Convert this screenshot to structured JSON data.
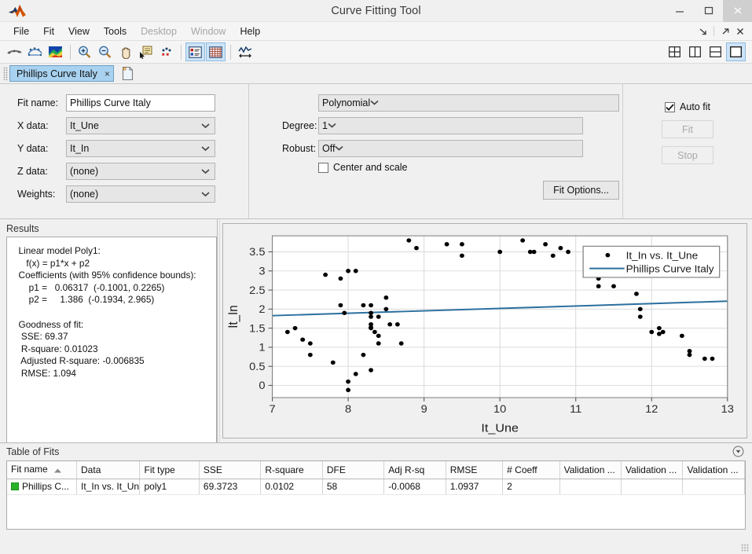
{
  "window": {
    "title": "Curve Fitting Tool",
    "logo_icon": "matlab-logo-icon",
    "minimize_label": "–",
    "maximize_label": "❐",
    "close_label": "✕"
  },
  "menubar": {
    "items": [
      {
        "label": "File",
        "disabled": false
      },
      {
        "label": "Fit",
        "disabled": false
      },
      {
        "label": "View",
        "disabled": false
      },
      {
        "label": "Tools",
        "disabled": false
      },
      {
        "label": "Desktop",
        "disabled": true
      },
      {
        "label": "Window",
        "disabled": true
      },
      {
        "label": "Help",
        "disabled": false
      }
    ],
    "dock_icon": "dock-arrow-icon",
    "undock_icon": "undock-arrow-icon",
    "close_icon": "close-icon"
  },
  "toolbar": {
    "buttons": [
      {
        "name": "fit-curve-icon",
        "label": ""
      },
      {
        "name": "fit-surface-icon",
        "label": ""
      },
      {
        "name": "colormap-surface-icon",
        "label": ""
      },
      {
        "name": "zoom-in-icon",
        "label": ""
      },
      {
        "name": "zoom-out-icon",
        "label": ""
      },
      {
        "name": "pan-hand-icon",
        "label": ""
      },
      {
        "name": "data-cursor-icon",
        "label": ""
      },
      {
        "name": "exclude-outliers-icon",
        "label": ""
      },
      {
        "name": "legend-toggle-icon",
        "label": ""
      },
      {
        "name": "grid-toggle-icon",
        "label": ""
      },
      {
        "name": "axes-limits-icon",
        "label": ""
      }
    ],
    "layouts": [
      {
        "name": "layout-grid-icon",
        "selected": false
      },
      {
        "name": "layout-columns-icon",
        "selected": false
      },
      {
        "name": "layout-rows-icon",
        "selected": false
      },
      {
        "name": "layout-single-icon",
        "selected": true
      }
    ]
  },
  "tabs": {
    "active": {
      "label": "Phillips Curve Italy",
      "close_label": "×"
    },
    "new_tab_icon": "new-fit-icon"
  },
  "fit_setup": {
    "fit_name_label": "Fit name:",
    "fit_name_value": "Phillips Curve Italy",
    "x_data_label": "X data:",
    "x_data_value": "It_Une",
    "y_data_label": "Y data:",
    "y_data_value": "It_In",
    "z_data_label": "Z data:",
    "z_data_value": "(none)",
    "weights_label": "Weights:",
    "weights_value": "(none)"
  },
  "fit_type": {
    "model_value": "Polynomial",
    "degree_label": "Degree:",
    "degree_value": "1",
    "robust_label": "Robust:",
    "robust_value": "Off",
    "center_and_scale_label": "Center and scale",
    "center_and_scale_checked": false,
    "fit_options_button": "Fit Options..."
  },
  "fit_controls": {
    "auto_fit_label": "Auto fit",
    "auto_fit_checked": true,
    "fit_button": "Fit",
    "fit_button_disabled": true,
    "stop_button": "Stop",
    "stop_button_disabled": true
  },
  "results": {
    "title": "Results",
    "text": "  Linear model Poly1:\n     f(x) = p1*x + p2\n  Coefficients (with 95% confidence bounds):\n      p1 =   0.06317  (-0.1001, 0.2265)\n      p2 =     1.386  (-0.1934, 2.965)\n\n  Goodness of fit:\n   SSE: 69.37\n   R-square: 0.01023\n   Adjusted R-square: -0.006835\n   RMSE: 1.094"
  },
  "table_of_fits": {
    "title": "Table of Fits",
    "collapse_icon": "chevron-down-circle-icon",
    "columns": [
      "Fit name",
      "Data",
      "Fit type",
      "SSE",
      "R-square",
      "DFE",
      "Adj R-sq",
      "RMSE",
      "# Coeff",
      "Validation ...",
      "Validation ...",
      "Validation ..."
    ],
    "sorted_column": "Fit name",
    "sort_direction": "ascending",
    "rows": [
      {
        "status_color": "#2ab22a",
        "cells": [
          "Phillips C...",
          "It_In vs. It_Une",
          "poly1",
          "69.3723",
          "0.0102",
          "58",
          "-0.0068",
          "1.0937",
          "2",
          "",
          "",
          ""
        ]
      }
    ]
  },
  "chart_data": {
    "type": "scatter",
    "title": "",
    "xlabel": "It_Une",
    "ylabel": "It_In",
    "xlim": [
      7,
      13
    ],
    "ylim": [
      -0.32,
      3.92
    ],
    "xticks": [
      7,
      8,
      9,
      10,
      11,
      12,
      13
    ],
    "yticks": [
      0,
      0.5,
      1,
      1.5,
      2,
      2.5,
      3,
      3.5
    ],
    "grid": true,
    "legend_position": "top-right",
    "legend": [
      {
        "label": "It_In vs. It_Une",
        "marker": "dot",
        "color": "#000000"
      },
      {
        "label": "Phillips Curve Italy",
        "marker": "line",
        "color": "#2b6f9e"
      }
    ],
    "series": [
      {
        "name": "It_In vs. It_Une",
        "type": "scatter",
        "marker_color": "#000000",
        "points": [
          [
            7.2,
            1.4
          ],
          [
            7.3,
            1.5
          ],
          [
            7.4,
            1.2
          ],
          [
            7.5,
            1.1
          ],
          [
            7.5,
            0.8
          ],
          [
            7.7,
            2.9
          ],
          [
            7.8,
            0.6
          ],
          [
            7.9,
            2.8
          ],
          [
            7.9,
            2.1
          ],
          [
            7.95,
            1.9
          ],
          [
            8.0,
            3.0
          ],
          [
            8.0,
            0.1
          ],
          [
            8.0,
            -0.12
          ],
          [
            8.1,
            3.0
          ],
          [
            8.1,
            0.3
          ],
          [
            8.2,
            2.1
          ],
          [
            8.2,
            0.8
          ],
          [
            8.3,
            2.1
          ],
          [
            8.3,
            1.9
          ],
          [
            8.3,
            1.8
          ],
          [
            8.3,
            1.6
          ],
          [
            8.3,
            1.5
          ],
          [
            8.3,
            1.52
          ],
          [
            8.3,
            0.4
          ],
          [
            8.35,
            1.4
          ],
          [
            8.4,
            1.8
          ],
          [
            8.4,
            1.3
          ],
          [
            8.4,
            1.1
          ],
          [
            8.5,
            2.3
          ],
          [
            8.5,
            2.0
          ],
          [
            8.55,
            1.6
          ],
          [
            8.65,
            1.6
          ],
          [
            8.7,
            1.1
          ],
          [
            8.8,
            3.8
          ],
          [
            8.9,
            3.6
          ],
          [
            9.3,
            3.7
          ],
          [
            9.5,
            3.7
          ],
          [
            9.5,
            3.4
          ],
          [
            10.0,
            3.5
          ],
          [
            10.3,
            3.8
          ],
          [
            10.4,
            3.5
          ],
          [
            10.45,
            3.5
          ],
          [
            10.6,
            3.7
          ],
          [
            10.7,
            3.4
          ],
          [
            10.8,
            3.6
          ],
          [
            10.9,
            3.5
          ],
          [
            11.3,
            2.8
          ],
          [
            11.3,
            2.6
          ],
          [
            11.5,
            2.6
          ],
          [
            11.8,
            2.4
          ],
          [
            11.85,
            2.0
          ],
          [
            11.85,
            1.8
          ],
          [
            12.0,
            1.4
          ],
          [
            12.1,
            1.5
          ],
          [
            12.1,
            1.35
          ],
          [
            12.15,
            1.4
          ],
          [
            12.4,
            1.3
          ],
          [
            12.5,
            0.9
          ],
          [
            12.5,
            0.8
          ],
          [
            12.7,
            0.7
          ],
          [
            12.8,
            0.7
          ]
        ]
      },
      {
        "name": "Phillips Curve Italy",
        "type": "line",
        "line_color": "#2b6f9e",
        "equation": "f(x) = 0.06317*x + 1.386",
        "endpoints": [
          [
            7,
            1.828
          ],
          [
            13,
            2.207
          ]
        ]
      }
    ]
  }
}
